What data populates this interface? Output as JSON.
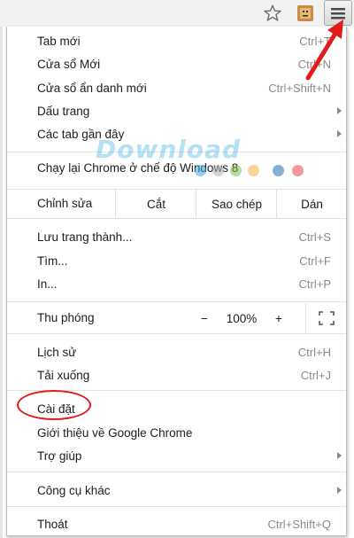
{
  "toolbar": {
    "star_icon": "star-outline-icon",
    "extension_icon": "extension-icon",
    "menu_icon": "hamburger-menu-icon"
  },
  "menu": {
    "group1": [
      {
        "label": "Tab mới",
        "shortcut": "Ctrl+T"
      },
      {
        "label": "Cửa sổ Mới",
        "shortcut": "Ctrl+N"
      },
      {
        "label": "Cửa sổ ẩn danh mới",
        "shortcut": "Ctrl+Shift+N"
      },
      {
        "label": "Dấu trang",
        "submenu": true
      },
      {
        "label": "Các tab gần đây",
        "submenu": true
      }
    ],
    "relaunch": {
      "label": "Chạy lại Chrome ở chế độ Windows 8"
    },
    "edit": {
      "label": "Chỉnh sửa",
      "cut": "Cắt",
      "copy": "Sao chép",
      "paste": "Dán"
    },
    "group2": [
      {
        "label": "Lưu trang thành...",
        "shortcut": "Ctrl+S"
      },
      {
        "label": "Tìm...",
        "shortcut": "Ctrl+F"
      },
      {
        "label": "In...",
        "shortcut": "Ctrl+P"
      }
    ],
    "zoom": {
      "label": "Thu phóng",
      "minus": "−",
      "value": "100%",
      "plus": "+",
      "fullscreen_icon": "fullscreen-icon"
    },
    "group3": [
      {
        "label": "Lịch sử",
        "shortcut": "Ctrl+H"
      },
      {
        "label": "Tải xuống",
        "shortcut": "Ctrl+J"
      }
    ],
    "group4": [
      {
        "label": "Cài đặt"
      },
      {
        "label": "Giới thiệu về Google Chrome"
      },
      {
        "label": "Trợ giúp",
        "submenu": true
      }
    ],
    "group5": [
      {
        "label": "Công cụ khác",
        "submenu": true
      }
    ],
    "group6": [
      {
        "label": "Thoát",
        "shortcut": "Ctrl+Shift+Q"
      }
    ]
  },
  "watermark": {
    "text": "Download"
  },
  "colors": {
    "highlight": "#e21b1b",
    "shortcut_text": "#8a8a8a",
    "separator": "#e3e3e3"
  }
}
